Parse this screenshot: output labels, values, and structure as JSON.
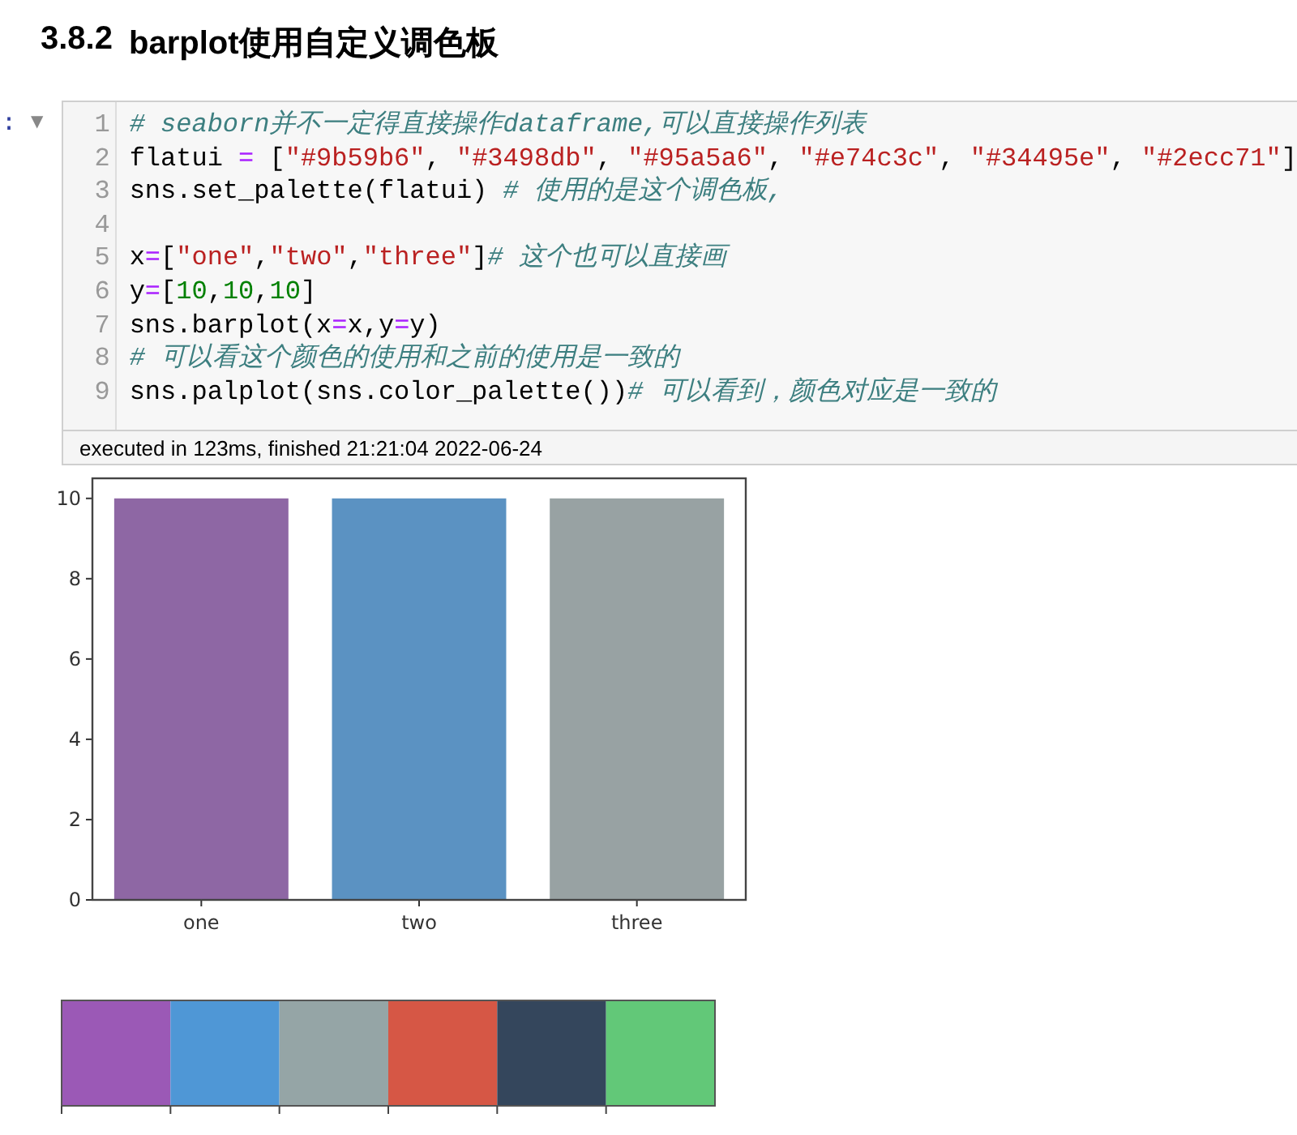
{
  "heading": {
    "number": "3.8.2",
    "title": "barplot使用自定义调色板"
  },
  "cell": {
    "prompt": ":",
    "collapse_icon": "▼",
    "lines": [
      {
        "number": "1",
        "tokens": [
          {
            "kind": "comment",
            "text": "# seaborn并不一定得直接操作dataframe,可以直接操作列表"
          }
        ]
      },
      {
        "number": "2",
        "tokens": [
          {
            "kind": "name",
            "text": "flatui "
          },
          {
            "kind": "op",
            "text": "="
          },
          {
            "kind": "name",
            "text": " ["
          },
          {
            "kind": "string",
            "text": "\"#9b59b6\""
          },
          {
            "kind": "name",
            "text": ", "
          },
          {
            "kind": "string",
            "text": "\"#3498db\""
          },
          {
            "kind": "name",
            "text": ", "
          },
          {
            "kind": "string",
            "text": "\"#95a5a6\""
          },
          {
            "kind": "name",
            "text": ", "
          },
          {
            "kind": "string",
            "text": "\"#e74c3c\""
          },
          {
            "kind": "name",
            "text": ", "
          },
          {
            "kind": "string",
            "text": "\"#34495e\""
          },
          {
            "kind": "name",
            "text": ", "
          },
          {
            "kind": "string",
            "text": "\"#2ecc71\""
          },
          {
            "kind": "name",
            "text": "]"
          }
        ]
      },
      {
        "number": "3",
        "tokens": [
          {
            "kind": "name",
            "text": "sns.set_palette(flatui) "
          },
          {
            "kind": "comment",
            "text": "# 使用的是这个调色板,"
          }
        ]
      },
      {
        "number": "4"
      },
      {
        "number": "5",
        "tokens": [
          {
            "kind": "name",
            "text": "x"
          },
          {
            "kind": "op",
            "text": "="
          },
          {
            "kind": "name",
            "text": "["
          },
          {
            "kind": "string",
            "text": "\"one\""
          },
          {
            "kind": "name",
            "text": ","
          },
          {
            "kind": "string",
            "text": "\"two\""
          },
          {
            "kind": "name",
            "text": ","
          },
          {
            "kind": "string",
            "text": "\"three\""
          },
          {
            "kind": "name",
            "text": "]"
          },
          {
            "kind": "comment",
            "text": "# 这个也可以直接画"
          }
        ]
      },
      {
        "number": "6",
        "tokens": [
          {
            "kind": "name",
            "text": "y"
          },
          {
            "kind": "op",
            "text": "="
          },
          {
            "kind": "name",
            "text": "["
          },
          {
            "kind": "number",
            "text": "10"
          },
          {
            "kind": "name",
            "text": ","
          },
          {
            "kind": "number",
            "text": "10"
          },
          {
            "kind": "name",
            "text": ","
          },
          {
            "kind": "number",
            "text": "10"
          },
          {
            "kind": "name",
            "text": "]"
          }
        ]
      },
      {
        "number": "7",
        "tokens": [
          {
            "kind": "name",
            "text": "sns.barplot(x"
          },
          {
            "kind": "op",
            "text": "="
          },
          {
            "kind": "name",
            "text": "x,y"
          },
          {
            "kind": "op",
            "text": "="
          },
          {
            "kind": "name",
            "text": "y)"
          }
        ]
      },
      {
        "number": "8",
        "tokens": [
          {
            "kind": "comment",
            "text": "# 可以看这个颜色的使用和之前的使用是一致的"
          }
        ]
      },
      {
        "number": "9",
        "tokens": [
          {
            "kind": "name",
            "text": "sns.palplot(sns.color_palette())"
          },
          {
            "kind": "comment",
            "text": "# 可以看到，颜色对应是一致的"
          }
        ]
      }
    ],
    "status": "executed in 123ms, finished 21:21:04 2022-06-24"
  },
  "output": {
    "chart_data": {
      "type": "bar",
      "categories": [
        "one",
        "two",
        "three"
      ],
      "values": [
        10,
        10,
        10
      ],
      "colors": [
        "#8e67a4",
        "#5b92c2",
        "#98a2a3"
      ],
      "ylim": [
        0,
        10.5
      ],
      "yticks": [
        0,
        2,
        4,
        6,
        8,
        10
      ]
    },
    "palette": [
      {
        "color": "#9b59b6"
      },
      {
        "color": "#4f97d6"
      },
      {
        "color": "#95a5a6"
      },
      {
        "color": "#d65745"
      },
      {
        "color": "#34465c"
      },
      {
        "color": "#62c878"
      }
    ]
  }
}
